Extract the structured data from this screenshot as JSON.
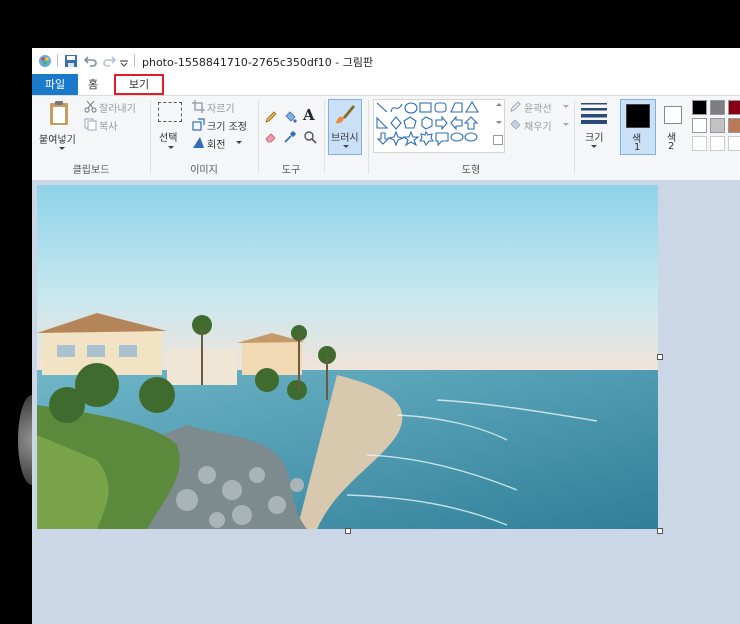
{
  "window": {
    "title": "photo-1558841710-2765c350df10 - 그림판"
  },
  "tabs": [
    {
      "label": "파일"
    },
    {
      "label": "홈"
    },
    {
      "label": "보기"
    }
  ],
  "ribbon": {
    "clipboard": {
      "paste": "붙여넣기",
      "cut": "잘라내기",
      "copy": "복사",
      "group": "클립보드"
    },
    "image": {
      "select": "선택",
      "crop": "자르기",
      "resize": "크기 조정",
      "rotate": "회전",
      "group": "이미지"
    },
    "tools": {
      "group": "도구"
    },
    "brush": {
      "label": "브러시"
    },
    "shapes": {
      "outline": "윤곽선",
      "fill": "채우기",
      "group": "도형"
    },
    "size": {
      "label": "크기"
    },
    "color1": {
      "label_top": "색",
      "label_bottom": "1",
      "value": "#000000"
    },
    "color2": {
      "label_top": "색",
      "label_bottom": "2",
      "value": "#ffffff"
    },
    "palette": [
      "#000000",
      "#7f7f7f",
      "#880015",
      "#ffffff",
      "#c3c3c3",
      "#b97a57"
    ]
  },
  "accent": "#1979ca",
  "highlight": "#e51c23"
}
